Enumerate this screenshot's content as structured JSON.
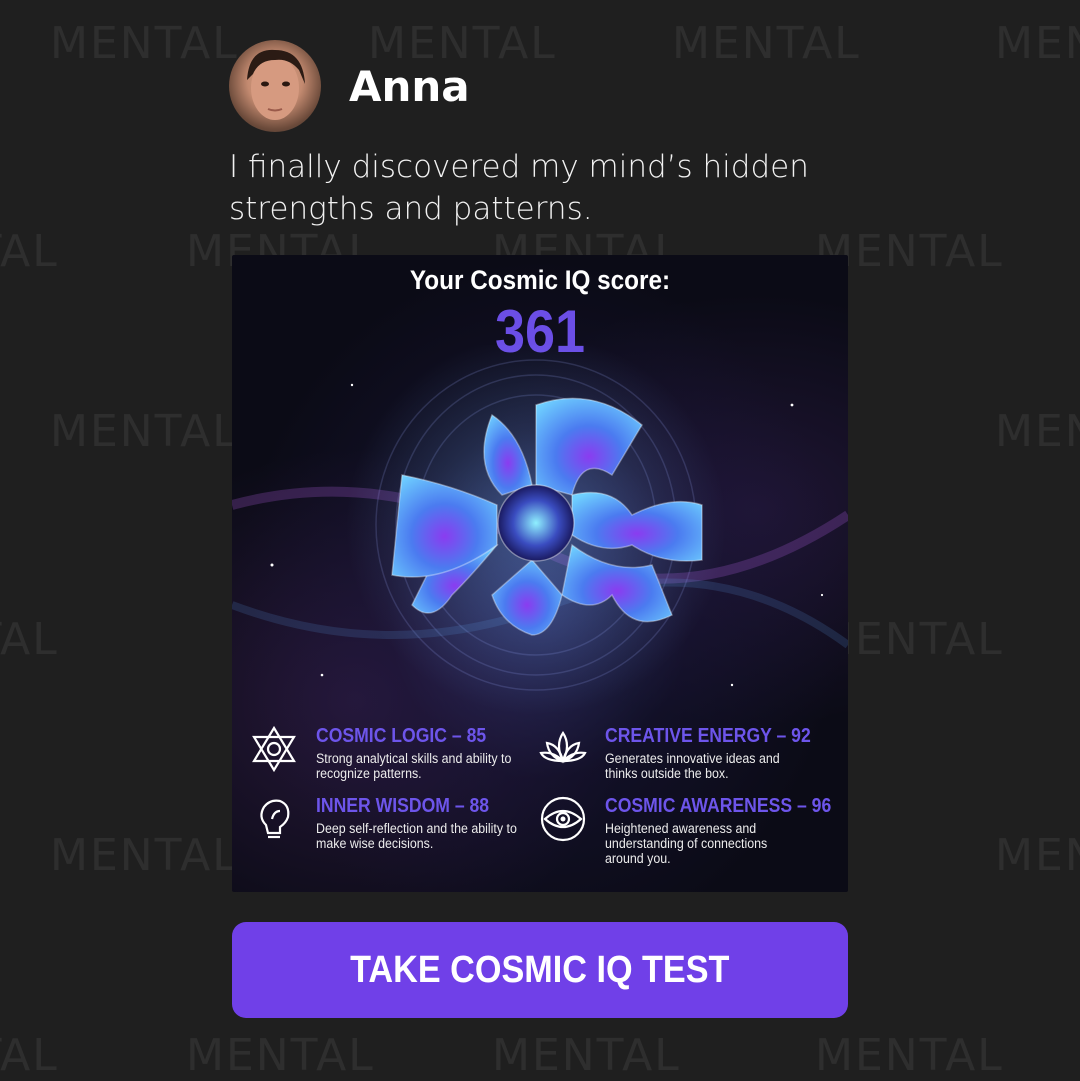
{
  "watermark": "MENTAL",
  "user": {
    "name": "Anna"
  },
  "testimonial": "I finally discovered my mind’s hidden strengths and patterns.",
  "result": {
    "label": "Your Cosmic IQ score:",
    "score": "361",
    "traits": [
      {
        "title": "COSMIC LOGIC – 85",
        "description": "Strong analytical skills and ability to recognize patterns.",
        "icon": "hexagram-icon"
      },
      {
        "title": "CREATIVE ENERGY  – 92",
        "description": "Generates innovative ideas and thinks outside the box.",
        "icon": "lotus-icon"
      },
      {
        "title": "INNER WISDOM – 88",
        "description": "Deep self-reflection and the ability to make wise decisions.",
        "icon": "lightbulb-icon"
      },
      {
        "title": "COSMIC AWARENESS – 96",
        "description": "Heightened awareness and understanding of connections around you.",
        "icon": "eye-icon"
      }
    ]
  },
  "cta": {
    "label": "TAKE COSMIC IQ TEST"
  },
  "colors": {
    "background": "#1f1f1f",
    "accent": "#7040e8",
    "score": "#6b4ee6",
    "trait_title": "#6d55ea"
  }
}
